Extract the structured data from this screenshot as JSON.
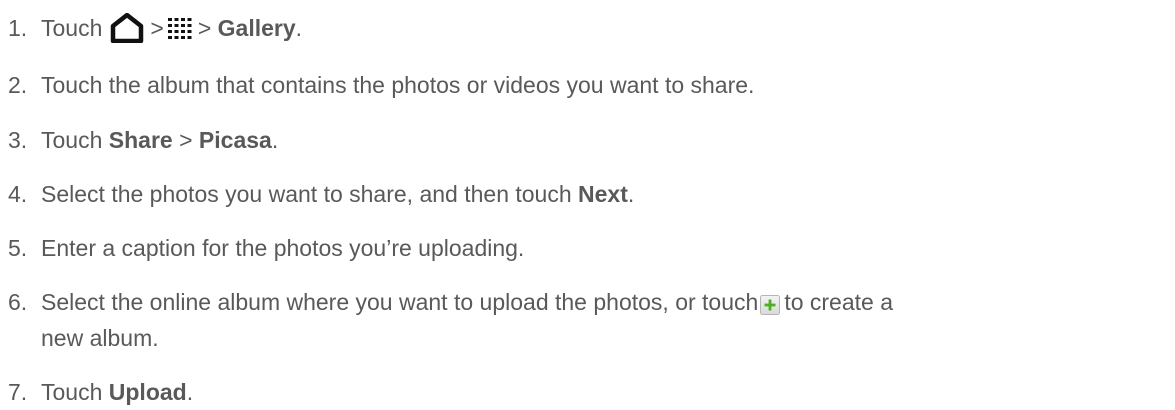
{
  "steps": [
    {
      "number": "1.",
      "t1": "Touch",
      "t2": ">",
      "t3": ">",
      "b1": "Gallery",
      "t4": "."
    },
    {
      "number": "2.",
      "text": "Touch the album that contains the photos or videos you want to share."
    },
    {
      "number": "3.",
      "t1": "Touch",
      "b1": "Share",
      "t2": ">",
      "b2": "Picasa",
      "t3": "."
    },
    {
      "number": "4.",
      "t1": "Select the photos you want to share, and then touch",
      "b1": "Next",
      "t2": "."
    },
    {
      "number": "5.",
      "text": "Enter a caption for the photos you’re uploading."
    },
    {
      "number": "6.",
      "t1": "Select the online album where you want to upload the photos, or touch",
      "t2": "to create a",
      "t3": "new album."
    },
    {
      "number": "7.",
      "t1": "Touch",
      "b1": "Upload",
      "t2": "."
    }
  ],
  "icons": {
    "home": "home-icon",
    "all_apps": "all-apps-grid-icon",
    "add": "add-plus-icon"
  },
  "colors": {
    "text": "#595959",
    "icon_dark": "#111111",
    "plus_green": "#4caf1f",
    "plus_box_bg": "#e8e8e8"
  }
}
